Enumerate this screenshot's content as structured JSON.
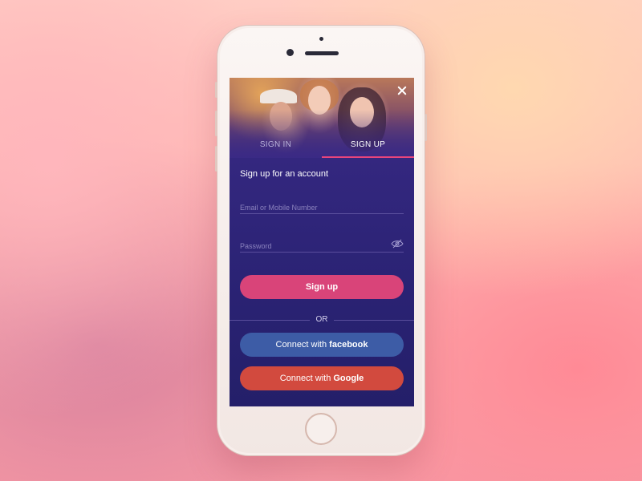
{
  "screen": {
    "tabs": [
      {
        "label": "SIGN IN",
        "active": false
      },
      {
        "label": "SIGN UP",
        "active": true
      }
    ],
    "form_title": "Sign up for an account",
    "email_placeholder": "Email or Mobile Number",
    "password_placeholder": "Password",
    "signup_button": "Sign up",
    "divider_text": "OR",
    "facebook_button": {
      "prefix": "Connect with",
      "brand": "facebook"
    },
    "google_button": {
      "prefix": "Connect with",
      "brand": "Google"
    },
    "icons": {
      "close": "close-icon",
      "password_visibility": "eye-slash-icon"
    }
  },
  "colors": {
    "primary": "#d94479",
    "facebook": "#3d5ca6",
    "google": "#d24a3e",
    "background": "#2b2375",
    "tab_indicator": "#e8457c"
  }
}
